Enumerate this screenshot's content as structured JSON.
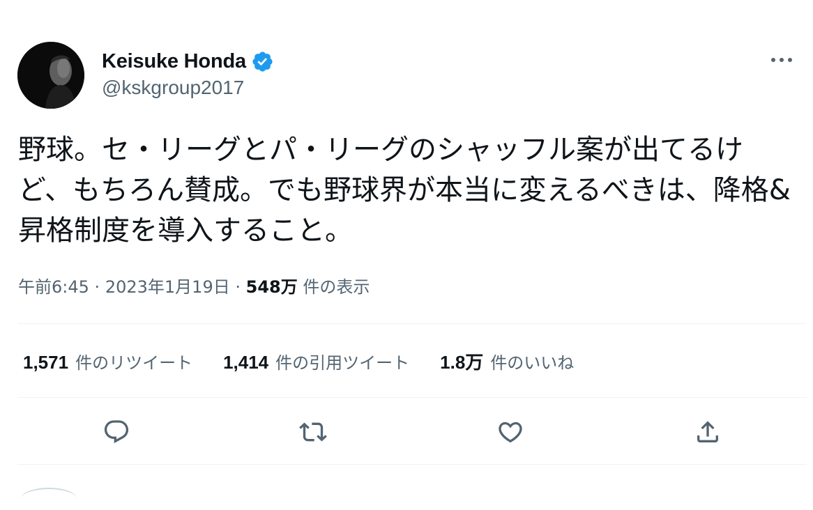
{
  "tweet": {
    "author": {
      "display_name": "Keisuke Honda",
      "handle": "@kskgroup2017",
      "verified": true,
      "avatar_icon": "profile-photo"
    },
    "text": "野球。セ・リーグとパ・リーグのシャッフル案が出てるけど、もちろん賛成。でも野球界が本当に変えるべきは、降格&昇格制度を導入すること。",
    "time": "午前6:45",
    "separator": "·",
    "date": "2023年1月19日",
    "views_count": "548万",
    "views_label": "件の表示",
    "stats": [
      {
        "count": "1,571",
        "label": "件のリツイート"
      },
      {
        "count": "1,414",
        "label": "件の引用ツイート"
      },
      {
        "count": "1.8万",
        "label": "件のいいね"
      }
    ],
    "actions": [
      {
        "icon": "reply-icon"
      },
      {
        "icon": "retweet-icon"
      },
      {
        "icon": "like-icon"
      },
      {
        "icon": "share-icon"
      }
    ]
  },
  "colors": {
    "text_primary": "#0f1419",
    "text_secondary": "#536471",
    "verified_blue": "#1d9bf0",
    "divider": "#eff3f4"
  }
}
